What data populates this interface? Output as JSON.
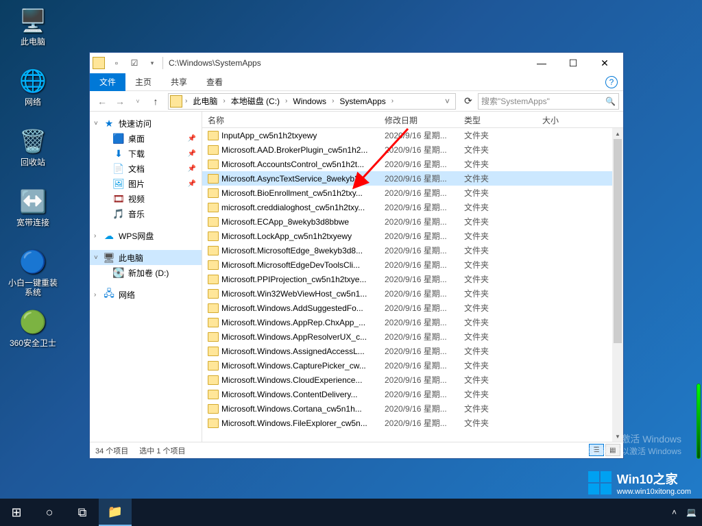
{
  "desktop": {
    "icons": [
      {
        "label": "此电脑",
        "glyph": "🖥️"
      },
      {
        "label": "网络",
        "glyph": "🌐"
      },
      {
        "label": "回收站",
        "glyph": "🗑️"
      },
      {
        "label": "宽带连接",
        "glyph": "↕️"
      },
      {
        "label": "小白一键重装\n系统",
        "glyph": "🔄"
      },
      {
        "label": "360安全卫士",
        "glyph": "🟢"
      }
    ]
  },
  "window": {
    "title_path": "C:\\Windows\\SystemApps",
    "ribbon": {
      "file": "文件",
      "home": "主页",
      "share": "共享",
      "view": "查看"
    },
    "breadcrumb": [
      "此电脑",
      "本地磁盘 (C:)",
      "Windows",
      "SystemApps"
    ],
    "search_placeholder": "搜索\"SystemApps\"",
    "columns": {
      "name": "名称",
      "date": "修改日期",
      "type": "类型",
      "size": "大小"
    },
    "status": {
      "count": "34 个项目",
      "selected": "选中 1 个项目"
    }
  },
  "sidebar": {
    "quick": "快速访问",
    "items": [
      {
        "label": "桌面",
        "icon": "🟦",
        "pin": true
      },
      {
        "label": "下载",
        "icon": "⬇",
        "pin": true
      },
      {
        "label": "文档",
        "icon": "📄",
        "pin": true
      },
      {
        "label": "图片",
        "icon": "🖼",
        "pin": true
      },
      {
        "label": "视频",
        "icon": "🎞",
        "pin": false
      },
      {
        "label": "音乐",
        "icon": "🎵",
        "pin": false
      }
    ],
    "wps": "WPS网盘",
    "this_pc": "此电脑",
    "volume": "新加卷 (D:)",
    "network": "网络"
  },
  "files": [
    {
      "name": "InputApp_cw5n1h2txyewy",
      "date": "2020/9/16 星期...",
      "type": "文件夹",
      "selected": false
    },
    {
      "name": "Microsoft.AAD.BrokerPlugin_cw5n1h2...",
      "date": "2020/9/16 星期...",
      "type": "文件夹",
      "selected": false
    },
    {
      "name": "Microsoft.AccountsControl_cw5n1h2t...",
      "date": "2020/9/16 星期...",
      "type": "文件夹",
      "selected": false
    },
    {
      "name": "Microsoft.AsyncTextService_8wekyb3...",
      "date": "2020/9/16 星期...",
      "type": "文件夹",
      "selected": true
    },
    {
      "name": "Microsoft.BioEnrollment_cw5n1h2txy...",
      "date": "2020/9/16 星期...",
      "type": "文件夹",
      "selected": false
    },
    {
      "name": "microsoft.creddialoghost_cw5n1h2txy...",
      "date": "2020/9/16 星期...",
      "type": "文件夹",
      "selected": false
    },
    {
      "name": "Microsoft.ECApp_8wekyb3d8bbwe",
      "date": "2020/9/16 星期...",
      "type": "文件夹",
      "selected": false
    },
    {
      "name": "Microsoft.LockApp_cw5n1h2txyewy",
      "date": "2020/9/16 星期...",
      "type": "文件夹",
      "selected": false
    },
    {
      "name": "Microsoft.MicrosoftEdge_8wekyb3d8...",
      "date": "2020/9/16 星期...",
      "type": "文件夹",
      "selected": false
    },
    {
      "name": "Microsoft.MicrosoftEdgeDevToolsCli...",
      "date": "2020/9/16 星期...",
      "type": "文件夹",
      "selected": false
    },
    {
      "name": "Microsoft.PPIProjection_cw5n1h2txye...",
      "date": "2020/9/16 星期...",
      "type": "文件夹",
      "selected": false
    },
    {
      "name": "Microsoft.Win32WebViewHost_cw5n1...",
      "date": "2020/9/16 星期...",
      "type": "文件夹",
      "selected": false
    },
    {
      "name": "Microsoft.Windows.AddSuggestedFo...",
      "date": "2020/9/16 星期...",
      "type": "文件夹",
      "selected": false
    },
    {
      "name": "Microsoft.Windows.AppRep.ChxApp_...",
      "date": "2020/9/16 星期...",
      "type": "文件夹",
      "selected": false
    },
    {
      "name": "Microsoft.Windows.AppResolverUX_c...",
      "date": "2020/9/16 星期...",
      "type": "文件夹",
      "selected": false
    },
    {
      "name": "Microsoft.Windows.AssignedAccessL...",
      "date": "2020/9/16 星期...",
      "type": "文件夹",
      "selected": false
    },
    {
      "name": "Microsoft.Windows.CapturePicker_cw...",
      "date": "2020/9/16 星期...",
      "type": "文件夹",
      "selected": false
    },
    {
      "name": "Microsoft.Windows.CloudExperience...",
      "date": "2020/9/16 星期...",
      "type": "文件夹",
      "selected": false
    },
    {
      "name": "Microsoft.Windows.ContentDelivery...",
      "date": "2020/9/16 星期...",
      "type": "文件夹",
      "selected": false
    },
    {
      "name": "Microsoft.Windows.Cortana_cw5n1h...",
      "date": "2020/9/16 星期...",
      "type": "文件夹",
      "selected": false
    },
    {
      "name": "Microsoft.Windows.FileExplorer_cw5n...",
      "date": "2020/9/16 星期...",
      "type": "文件夹",
      "selected": false
    }
  ],
  "watermark": {
    "line1": "激活 Windows",
    "line2": "转到\"设置\"以激活 Windows",
    "brand": "Win10之家",
    "url": "www.win10xitong.com"
  }
}
